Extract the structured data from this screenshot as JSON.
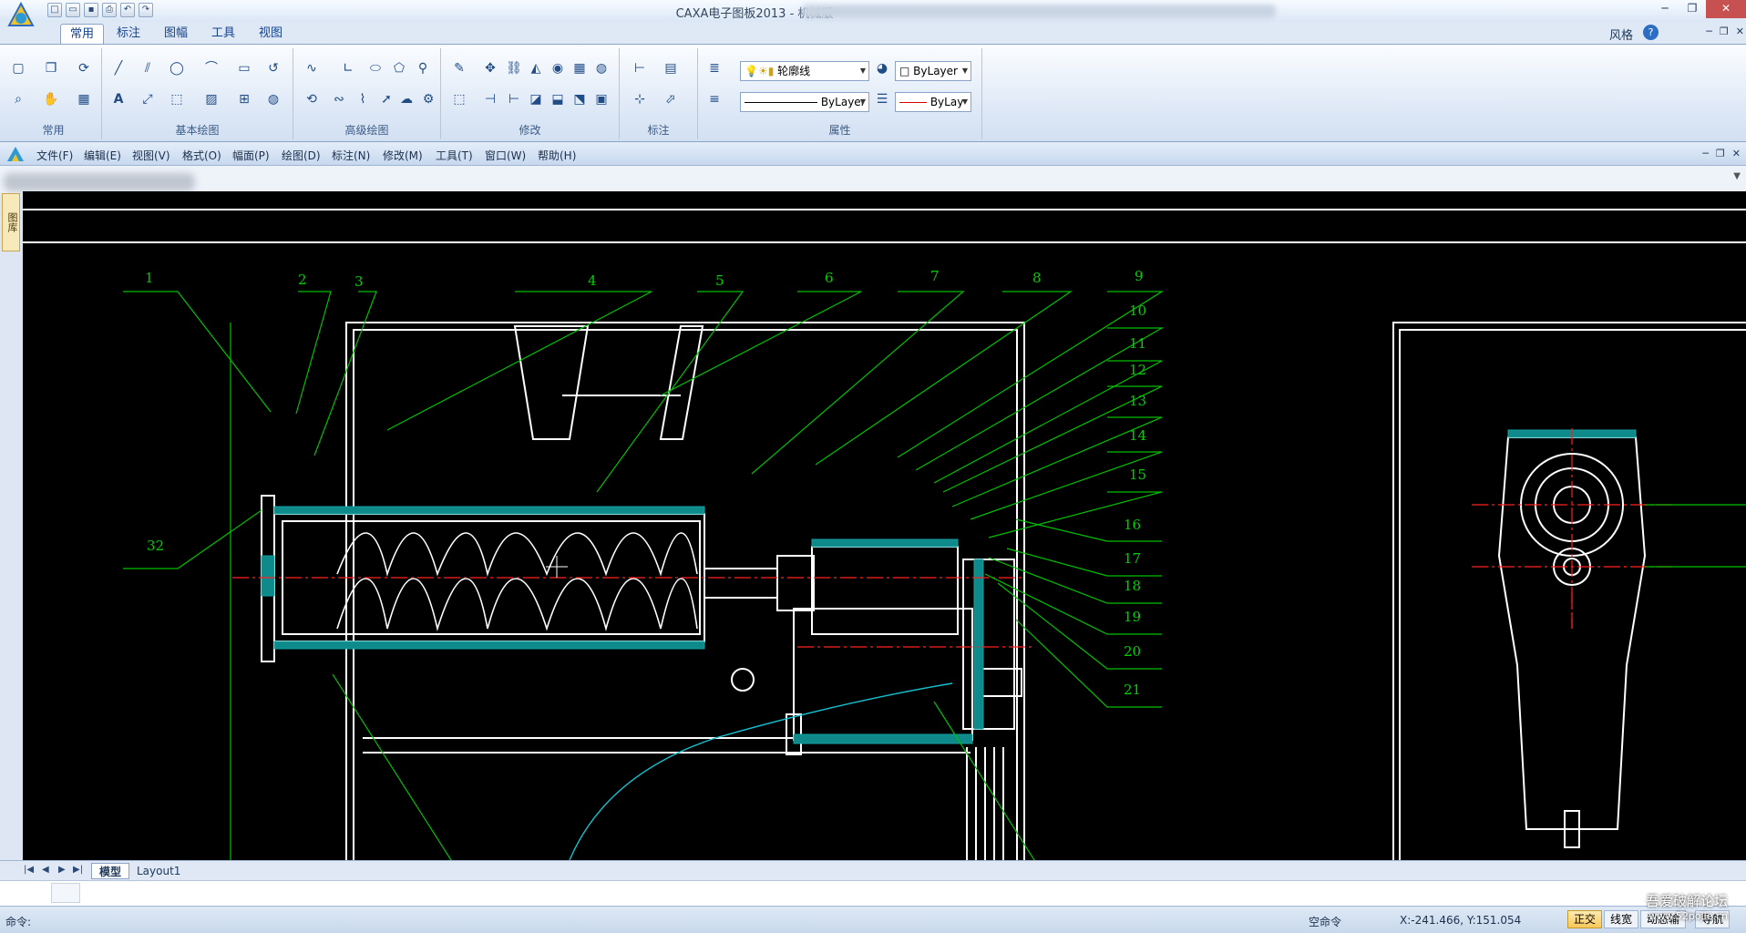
{
  "app": {
    "title": "CAXA电子图板2013 - 机械版"
  },
  "ribbon_tabs": [
    "常用",
    "标注",
    "图幅",
    "工具",
    "视图"
  ],
  "style_label": "风格",
  "ribbon_groups": [
    "常用",
    "基本绘图",
    "高级绘图",
    "修改",
    "标注",
    "属性"
  ],
  "properties": {
    "layer": "轮廓线",
    "color": "ByLayer",
    "linetype": "ByLayer",
    "lineweight": "ByLay"
  },
  "menu": [
    "文件(F)",
    "编辑(E)",
    "视图(V)",
    "格式(O)",
    "幅面(P)",
    "绘图(D)",
    "标注(N)",
    "修改(M)",
    "工具(T)",
    "窗口(W)",
    "帮助(H)"
  ],
  "side_tab": "图库",
  "callouts": [
    "1",
    "2",
    "3",
    "4",
    "5",
    "6",
    "7",
    "8",
    "9",
    "10",
    "11",
    "12",
    "13",
    "14",
    "15",
    "16",
    "17",
    "18",
    "19",
    "20",
    "21",
    "32"
  ],
  "layout_tabs": [
    "模型",
    "Layout1"
  ],
  "command": {
    "prompt": "命令:",
    "status": "空命令",
    "coords": "X:-241.466, Y:151.054"
  },
  "status_buttons": [
    "正交",
    "线宽",
    "动态输",
    "导航"
  ],
  "watermark": {
    "line1": "吾爱破解论坛",
    "line2": "www.52pojie.cn"
  },
  "colors": {
    "canvas": "#000000",
    "leader": "#00c000",
    "drawing": "#ffffff",
    "hatch": "#14a0a0",
    "center": "#ff2020",
    "accent": "#2d6ec4"
  }
}
